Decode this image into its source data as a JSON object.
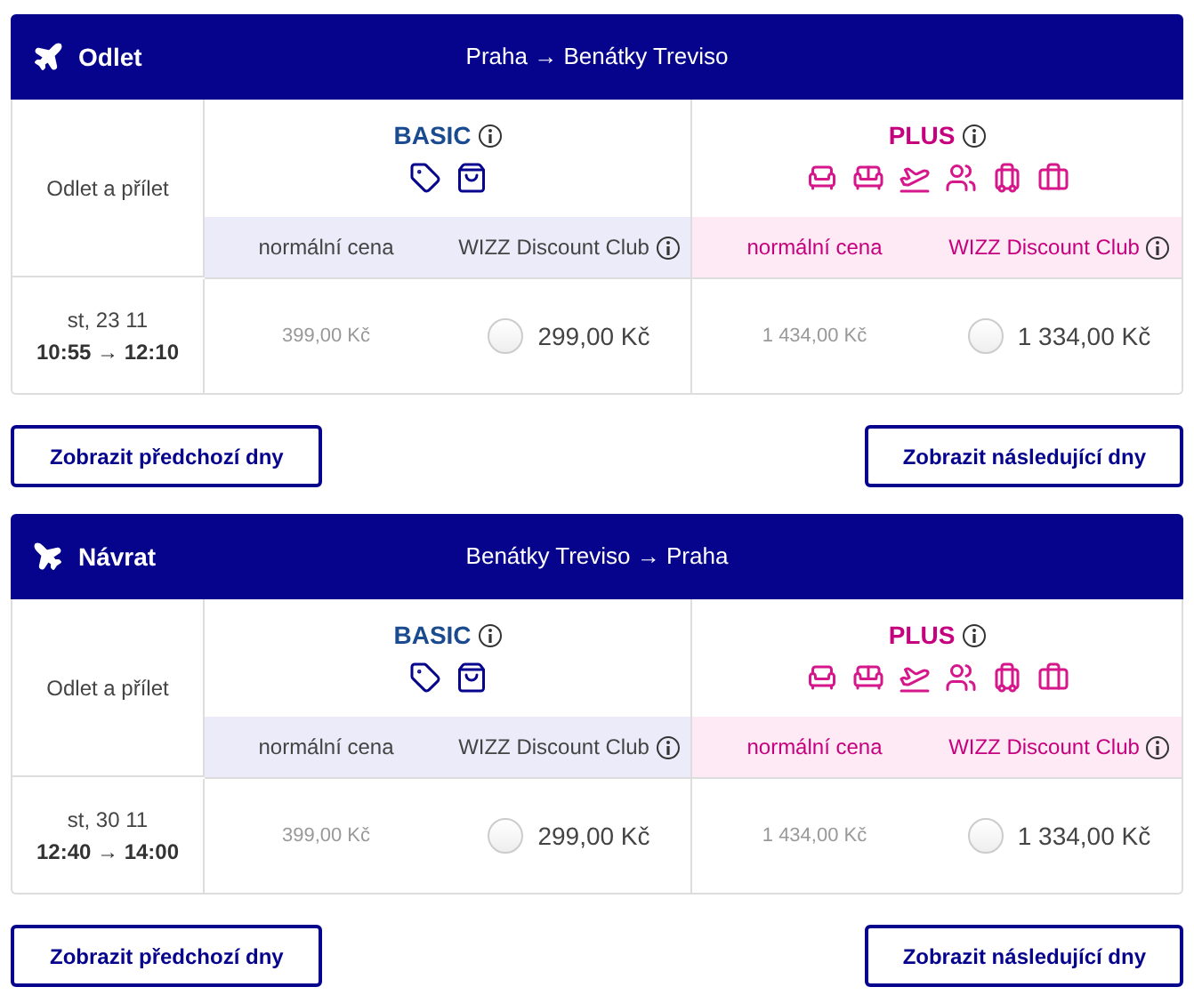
{
  "sections": [
    {
      "label": "Odlet",
      "route": "Praha → Benátky Treviso",
      "time_header": "Odlet a přílet",
      "kind": "departure",
      "fares": [
        {
          "kind": "basic",
          "name": "BASIC",
          "regular_label": "normální cena",
          "club_label": "WIZZ Discount Club"
        },
        {
          "kind": "plus",
          "name": "PLUS",
          "regular_label": "normální cena",
          "club_label": "WIZZ Discount Club"
        }
      ],
      "flight": {
        "date": "st, 23 11",
        "times": "10:55 → 12:10",
        "prices": [
          {
            "regular": "399,00 Kč",
            "club": "299,00 Kč",
            "selected": false
          },
          {
            "regular": "1 434,00 Kč",
            "club": "1 334,00 Kč",
            "selected": false
          }
        ]
      },
      "prev_button": "Zobrazit předchozí dny",
      "next_button": "Zobrazit následující dny"
    },
    {
      "label": "Návrat",
      "route": "Benátky Treviso → Praha",
      "time_header": "Odlet a přílet",
      "kind": "return",
      "fares": [
        {
          "kind": "basic",
          "name": "BASIC",
          "regular_label": "normální cena",
          "club_label": "WIZZ Discount Club"
        },
        {
          "kind": "plus",
          "name": "PLUS",
          "regular_label": "normální cena",
          "club_label": "WIZZ Discount Club"
        }
      ],
      "flight": {
        "date": "st, 30 11",
        "times": "12:40 → 14:00",
        "prices": [
          {
            "regular": "399,00 Kč",
            "club": "299,00 Kč",
            "selected": false
          },
          {
            "regular": "1 434,00 Kč",
            "club": "1 334,00 Kč",
            "selected": false
          }
        ]
      },
      "prev_button": "Zobrazit předchozí dny",
      "next_button": "Zobrazit následující dny"
    }
  ]
}
